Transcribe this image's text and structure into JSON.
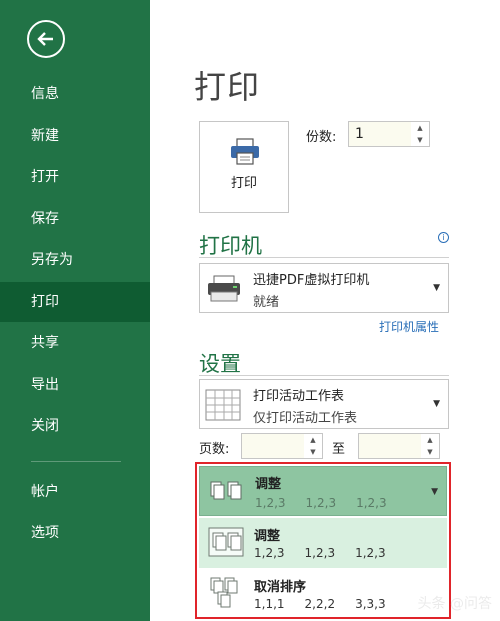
{
  "sidebar": {
    "items": [
      {
        "label": "信息"
      },
      {
        "label": "新建"
      },
      {
        "label": "打开"
      },
      {
        "label": "保存"
      },
      {
        "label": "另存为"
      },
      {
        "label": "打印"
      },
      {
        "label": "共享"
      },
      {
        "label": "导出"
      },
      {
        "label": "关闭"
      },
      {
        "label": "帐户"
      },
      {
        "label": "选项"
      }
    ],
    "active": "打印"
  },
  "main": {
    "title": "打印",
    "print_button_label": "打印",
    "copies_label": "份数:",
    "copies_value": "1"
  },
  "printer": {
    "heading": "打印机",
    "name": "迅捷PDF虚拟打印机",
    "status": "就绪",
    "properties_link": "打印机属性"
  },
  "settings": {
    "heading": "设置",
    "scope_main": "打印活动工作表",
    "scope_sub": "仅打印活动工作表",
    "pages_label": "页数:",
    "to_label": "至",
    "collation": {
      "selected": {
        "title": "调整",
        "nums": [
          "1,2,3",
          "1,2,3",
          "1,2,3"
        ]
      },
      "options": [
        {
          "title": "调整",
          "nums": [
            "1,2,3",
            "1,2,3",
            "1,2,3"
          ]
        },
        {
          "title": "取消排序",
          "nums": [
            "1,1,1",
            "2,2,2",
            "3,3,3"
          ]
        }
      ]
    }
  },
  "watermark": "头条 @问答",
  "colors": {
    "sidebar": "#217346",
    "accent_text": "#217346",
    "highlight_border": "#e0242a"
  }
}
